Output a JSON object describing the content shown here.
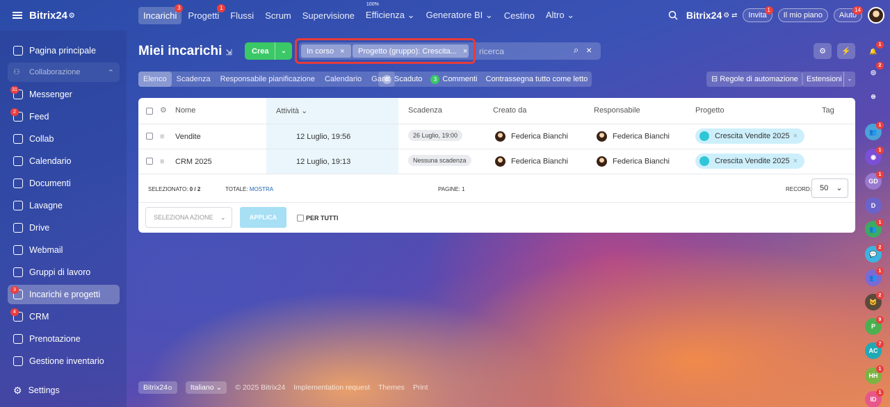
{
  "app": {
    "brand": "Bitrix24",
    "brand_mark": "⊙"
  },
  "nav": [
    {
      "label": "Incarichi",
      "badge": "3",
      "active": true
    },
    {
      "label": "Progetti",
      "badge": "1"
    },
    {
      "label": "Flussi"
    },
    {
      "label": "Scrum"
    },
    {
      "label": "Supervisione"
    },
    {
      "label": "Efficienza",
      "pct": "100%",
      "chevron": "⌄"
    },
    {
      "label": "Generatore BI",
      "chevron": "⌄"
    },
    {
      "label": "Cestino"
    },
    {
      "label": "Altro",
      "chevron": "⌄"
    }
  ],
  "top_right": {
    "brand": "Bitrix24",
    "invita": "Invita",
    "invita_badge": "1",
    "piano": "Il mio piano",
    "aiuto": "Aiuto",
    "aiuto_badge": "14"
  },
  "sidebar": {
    "items": [
      {
        "label": "Pagina principale",
        "icon": "home-icon"
      },
      {
        "label": "Collaborazione",
        "icon": "people-icon",
        "group": true
      },
      {
        "label": "Messenger",
        "icon": "chat-icon",
        "badge": "31"
      },
      {
        "label": "Feed",
        "icon": "feed-icon",
        "badge": "2"
      },
      {
        "label": "Collab",
        "icon": "collab-icon"
      },
      {
        "label": "Calendario",
        "icon": "calendar-icon"
      },
      {
        "label": "Documenti",
        "icon": "document-icon"
      },
      {
        "label": "Lavagne",
        "icon": "board-icon"
      },
      {
        "label": "Drive",
        "icon": "drive-icon"
      },
      {
        "label": "Webmail",
        "icon": "mail-icon"
      },
      {
        "label": "Gruppi di lavoro",
        "icon": "group-icon"
      },
      {
        "label": "Incarichi e progetti",
        "icon": "task-icon",
        "badge": "3",
        "active": true
      },
      {
        "label": "CRM",
        "icon": "crm-icon",
        "badge": "4"
      },
      {
        "label": "Prenotazione",
        "icon": "booking-icon"
      },
      {
        "label": "Gestione inventario",
        "icon": "inventory-icon"
      }
    ],
    "settings": "Settings"
  },
  "header": {
    "title": "Miei incarichi",
    "create": "Crea"
  },
  "filter": {
    "chips": [
      "In corso",
      "Progetto (gruppo): Crescita..."
    ],
    "placeholder": "ricerca"
  },
  "views": [
    "Elenco",
    "Scadenza",
    "Responsabile pianificazione",
    "Calendario",
    "Gantt"
  ],
  "counters": {
    "overdue_count": "0",
    "overdue_label": "Scaduto",
    "comments_count": "3",
    "comments_label": "Commenti",
    "mark_read": "Contrassegna tutto come letto"
  },
  "toolbar": {
    "automation": "Regole di automazione",
    "extensions": "Estensioni"
  },
  "table": {
    "columns": [
      "Nome",
      "Attività",
      "Scadenza",
      "Creato da",
      "Responsabile",
      "Progetto",
      "Tag"
    ],
    "rows": [
      {
        "name": "Vendite",
        "activity": "12 Luglio, 19:56",
        "deadline": "26 Luglio, 19:00",
        "creator": "Federica Bianchi",
        "responsible": "Federica Bianchi",
        "project": "Crescita Vendite 2025"
      },
      {
        "name": "CRM 2025",
        "activity": "12 Luglio, 19:13",
        "deadline": "Nessuna scadenza",
        "creator": "Federica Bianchi",
        "responsible": "Federica Bianchi",
        "project": "Crescita Vendite 2025"
      }
    ],
    "selected_label": "SELEZIONATO:",
    "selected_value": "0 / 2",
    "total_label": "TOTALE:",
    "total_link": "MOSTRA",
    "pages_label": "PAGINE:",
    "pages_value": "1",
    "record_label": "RECORD:",
    "record_value": "50",
    "action_placeholder": "SELEZIONA AZIONE",
    "apply": "APPLICA",
    "per_tutti": "PER TUTTI"
  },
  "rightbar": [
    {
      "badge": "1",
      "color": "transparent",
      "text": "🔔"
    },
    {
      "badge": "2",
      "color": "transparent",
      "text": "◎"
    },
    {
      "color": "transparent",
      "text": "⊜"
    },
    {
      "badge": "1",
      "color": "#4aa2d8",
      "text": "👥"
    },
    {
      "badge": "1",
      "color": "#7b4fd6",
      "text": "◉"
    },
    {
      "badge": "1",
      "color": "#9a7ad0",
      "text": "GD"
    },
    {
      "color": "#6b63c9",
      "text": "D"
    },
    {
      "badge": "1",
      "color": "#3caa62",
      "text": "👥"
    },
    {
      "badge": "2",
      "color": "#3db3e0",
      "text": "💬"
    },
    {
      "badge": "1",
      "color": "#7a6ad6",
      "text": "👥"
    },
    {
      "badge": "2",
      "color": "#5a4a3a",
      "text": "🐱"
    },
    {
      "badge": "9",
      "color": "#4caf50",
      "text": "P"
    },
    {
      "badge": "7",
      "color": "#1fa9b5",
      "text": "AC"
    },
    {
      "badge": "1",
      "color": "#7cb342",
      "text": "HH"
    },
    {
      "badge": "1",
      "color": "#e8578a",
      "text": "ID"
    }
  ],
  "footer": {
    "brand": "Bitrix24",
    "lang": "Italiano",
    "copyright": "© 2025 Bitrix24",
    "impl": "Implementation request",
    "themes": "Themes",
    "print": "Print"
  }
}
